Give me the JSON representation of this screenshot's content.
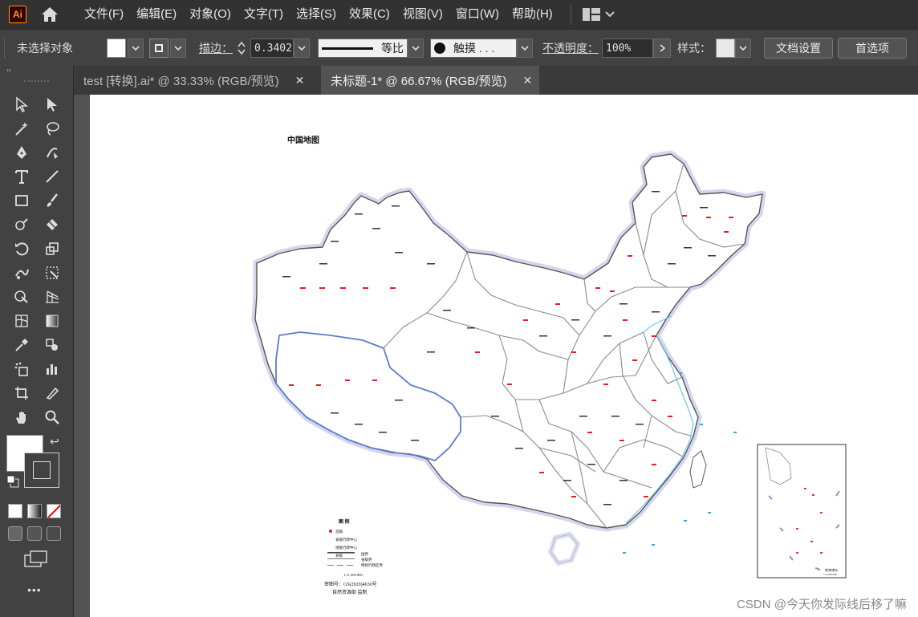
{
  "app": {
    "logo": "Ai"
  },
  "menu": [
    "文件(F)",
    "编辑(E)",
    "对象(O)",
    "文字(T)",
    "选择(S)",
    "效果(C)",
    "视图(V)",
    "窗口(W)",
    "帮助(H)"
  ],
  "control": {
    "selection": "未选择对象",
    "stroke_label": "描边：",
    "stroke_value": "0.3402",
    "profile_label": "等比",
    "brush_label": "触摸 . . .",
    "opacity_label": "不透明度：",
    "opacity_value": "100%",
    "style_label": "样式：",
    "doc_setup": "文档设置",
    "prefs": "首选项"
  },
  "tabs": [
    {
      "label": "test [转换].ai* @ 33.33% (RGB/预览)",
      "close": "✕"
    },
    {
      "label": "未标题-1* @ 66.67% (RGB/预览)",
      "close": "✕"
    }
  ],
  "toolbar": {
    "collapse": "‹‹",
    "more": "•••"
  },
  "map": {
    "title": "中国地图",
    "legend_title": "图 例",
    "legend_items": [
      "首都",
      "省级行政中心",
      "地级行政中心",
      "县级",
      "国界",
      "省级界",
      "特别行政区界"
    ],
    "scale": "1:11 000 000",
    "approval": "审图号：GS(2020)4630号",
    "publisher": "自然资源部 监制",
    "inset_title": "南海诸岛",
    "inset_scale": "1:4 500 000"
  },
  "watermark": "CSDN @今天你发际线后移了嘛",
  "colors": {
    "menubar": "#323232",
    "control": "#424242",
    "canvas": "#535353",
    "border_blue": "#5470c6",
    "halo": "#cfd2ef"
  }
}
